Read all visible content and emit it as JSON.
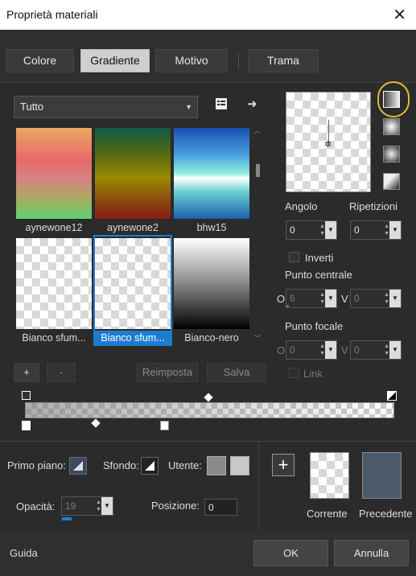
{
  "window": {
    "title": "Proprietà materiali",
    "close": "✕"
  },
  "tabs": [
    {
      "label": "Colore"
    },
    {
      "label": "Gradiente"
    },
    {
      "label": "Motivo"
    },
    {
      "label": "Trama"
    }
  ],
  "gradient_list": {
    "category": "Tutto",
    "items": [
      {
        "label": "aynewone12"
      },
      {
        "label": "aynewone2"
      },
      {
        "label": "bhw15"
      },
      {
        "label": "Bianco sfum..."
      },
      {
        "label": "Bianco sfum..."
      },
      {
        "label": "Bianco-nero"
      }
    ]
  },
  "list_buttons": {
    "add": "+",
    "remove": "-",
    "reset": "Reimposta",
    "save": "Salva"
  },
  "controls": {
    "angle_label": "Angolo",
    "angle_value": "0",
    "repeats_label": "Ripetizioni",
    "repeats_value": "0",
    "invert_label": "Inverti",
    "center_label": "Punto centrale",
    "center_o_label": "O",
    "center_o_value": "6",
    "center_v_label": "V",
    "center_v_value": "0",
    "focal_label": "Punto focale",
    "focal_o_label": "O",
    "focal_o_value": "0",
    "focal_v_label": "V",
    "focal_v_value": "0",
    "link_label": "Link"
  },
  "bottom": {
    "foreground_label": "Primo piano:",
    "background_label": "Sfondo:",
    "user_label": "Utente:",
    "opacity_label": "Opacità:",
    "opacity_value": "19",
    "position_label": "Posizione:",
    "position_value": "0",
    "current_label": "Corrente",
    "previous_label": "Precedente",
    "add_swatch": "+"
  },
  "footer": {
    "help": "Guida",
    "ok": "OK",
    "cancel": "Annulla"
  },
  "colors": {
    "accent": "#f0c040",
    "selection": "#1e7cd0",
    "previous_swatch": "#4a5a6a"
  }
}
